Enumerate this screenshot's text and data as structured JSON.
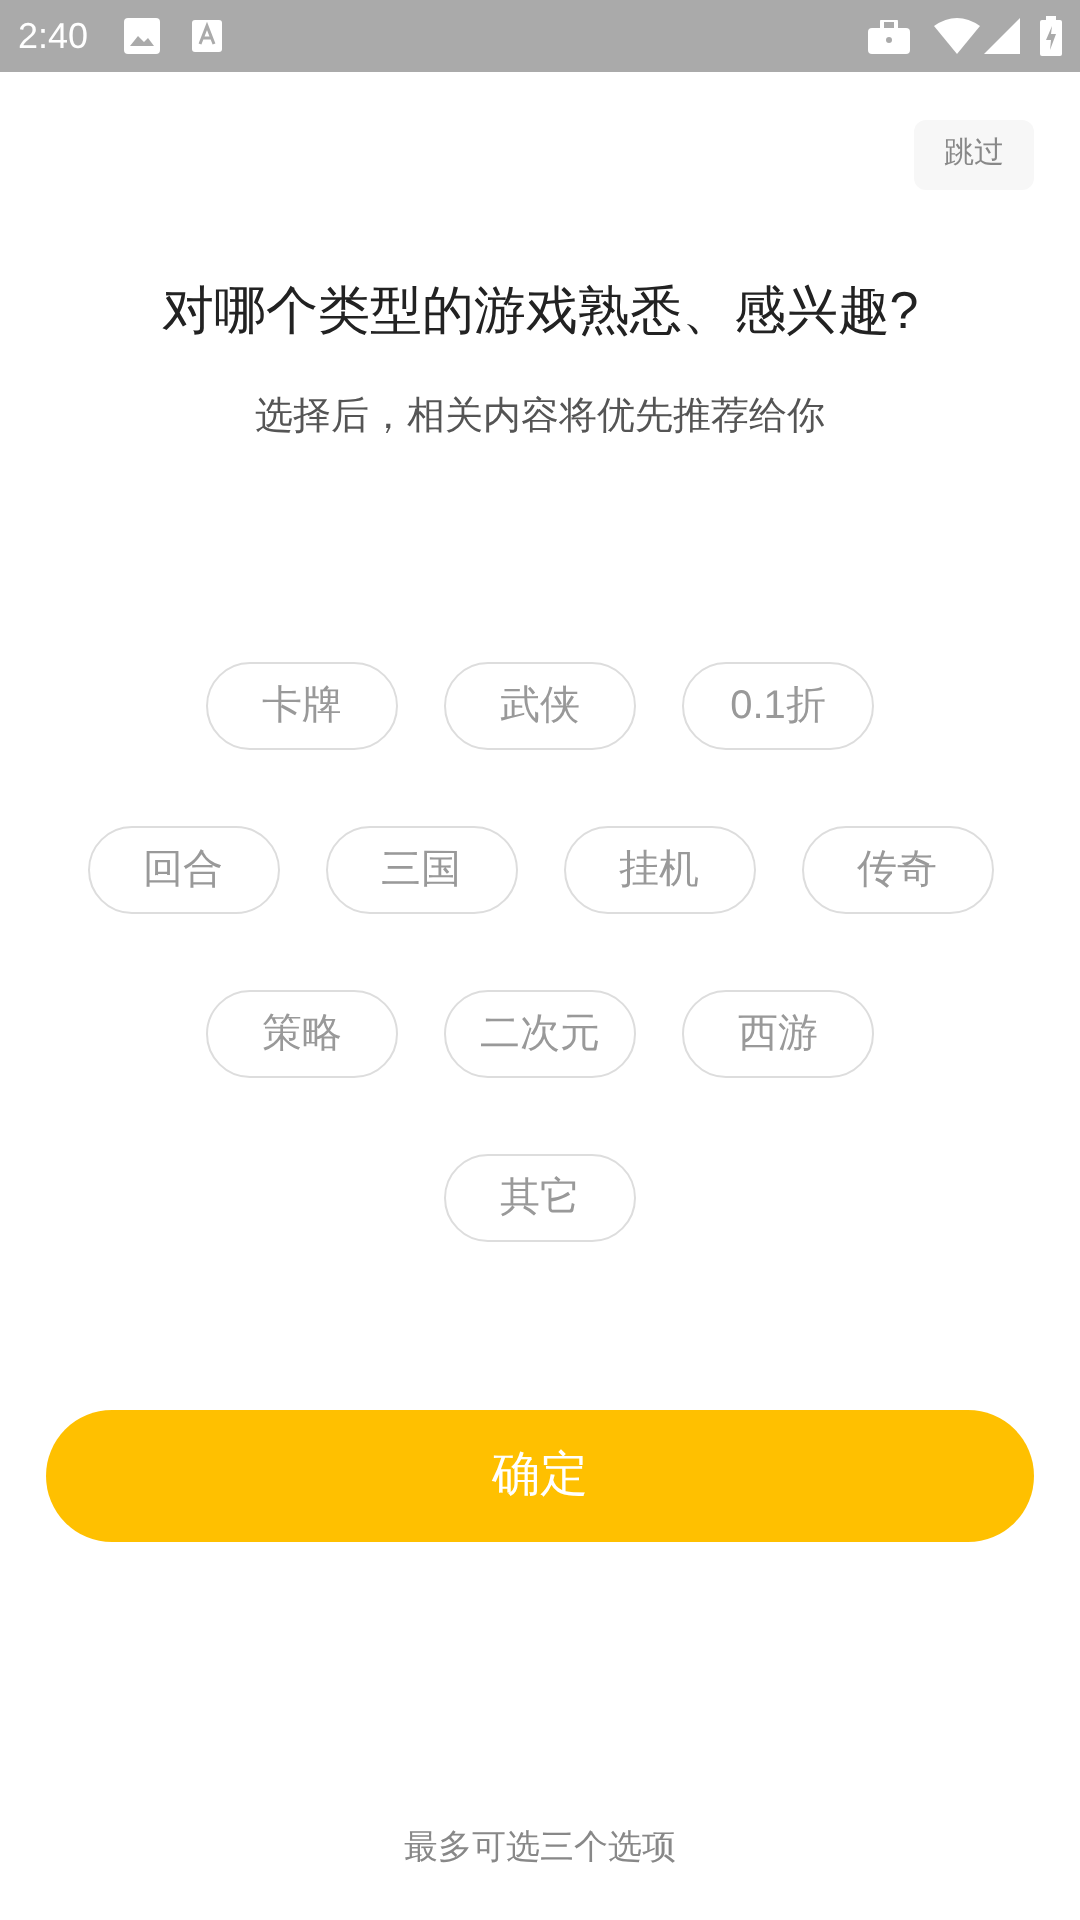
{
  "status_bar": {
    "time": "2:40"
  },
  "skip_button": {
    "label": "跳过"
  },
  "title": "对哪个类型的游戏熟悉、感兴趣?",
  "subtitle": "选择后，相关内容将优先推荐给你",
  "tag_rows": [
    [
      {
        "label": "卡牌",
        "selected": false
      },
      {
        "label": "武侠",
        "selected": false
      },
      {
        "label": "0.1折",
        "selected": false
      }
    ],
    [
      {
        "label": "回合",
        "selected": false
      },
      {
        "label": "三国",
        "selected": false
      },
      {
        "label": "挂机",
        "selected": false
      },
      {
        "label": "传奇",
        "selected": false
      }
    ],
    [
      {
        "label": "策略",
        "selected": false
      },
      {
        "label": "二次元",
        "selected": false
      },
      {
        "label": "西游",
        "selected": false
      }
    ],
    [
      {
        "label": "其它",
        "selected": false
      }
    ]
  ],
  "confirm_button": {
    "label": "确定"
  },
  "footer_note": "最多可选三个选项"
}
